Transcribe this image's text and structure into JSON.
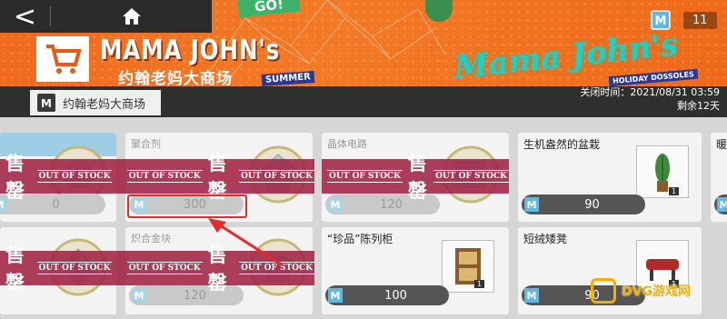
{
  "banner": {
    "english_title": "MAMA JOHN's",
    "chinese_title": "约翰老妈大商场",
    "summer_tag": "SUMMER",
    "go_tag": "GO!",
    "script_title": "Mama John's",
    "holiday_tag": "HOLIDAY DOSSOLES",
    "currency_count": "11",
    "currency_icon": "M"
  },
  "nav": {
    "back_glyph": "<",
    "home_icon": "home-icon"
  },
  "shop": {
    "tab_label": "约翰老妈大商场",
    "tab_icon": "M",
    "close_time": "关闭时间：2021/08/31 03:59",
    "remaining": "剩余12天"
  },
  "sold_out": {
    "chinese": "售罄",
    "english": "OUT OF STOCK"
  },
  "items": [
    {
      "name": "",
      "price": "0",
      "sold_out": true
    },
    {
      "name": "聚合剂",
      "price": "300",
      "sold_out": true
    },
    {
      "name": "晶体电路",
      "price": "120",
      "sold_out": true
    },
    {
      "name": "生机盎然的盆栽",
      "price": "90",
      "sold_out": false,
      "qty": "1"
    },
    {
      "name": "暖",
      "price": "",
      "sold_out": false
    },
    {
      "name": "",
      "price": "",
      "sold_out": true
    },
    {
      "name": "炽合金块",
      "price": "120",
      "sold_out": true
    },
    {
      "name": "“珍品”陈列柜",
      "price": "100",
      "sold_out": false,
      "qty": "1"
    },
    {
      "name": "短绒矮凳",
      "price": "90",
      "sold_out": false,
      "qty": "1"
    }
  ],
  "watermark": "DVG游戏网",
  "colors": {
    "banner_orange": "#f06a1f",
    "sold_out_band": "#a02346",
    "highlight_red": "#e32b2b",
    "currency_blue": "#5fb8e0"
  }
}
